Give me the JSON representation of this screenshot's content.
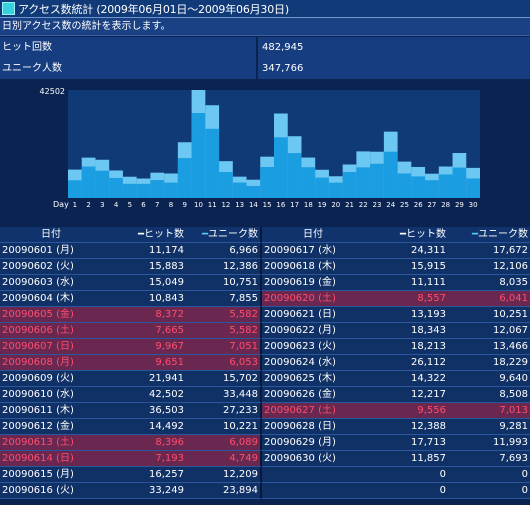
{
  "header": {
    "title": "アクセス数統計 (2009年06月01日～2009年06月30日)",
    "description": "日別アクセス数の統計を表示します。"
  },
  "summary": [
    {
      "label": "ヒット回数",
      "value": "482,945"
    },
    {
      "label": "ユニーク人数",
      "value": "347,766"
    }
  ],
  "colors": {
    "hits_bar": "#6cc8f2",
    "unique_bar": "#1b9de2",
    "weekend_row": "#6a2850",
    "weekend_text": "#ff4d6d",
    "plot_bg": "#0f3a76"
  },
  "chart_data": {
    "type": "bar",
    "max_label": "42502",
    "xlabel": "Day",
    "categories": [
      "1",
      "2",
      "3",
      "4",
      "5",
      "6",
      "7",
      "8",
      "9",
      "10",
      "11",
      "12",
      "13",
      "14",
      "15",
      "16",
      "17",
      "18",
      "19",
      "20",
      "21",
      "22",
      "23",
      "24",
      "25",
      "26",
      "27",
      "28",
      "29",
      "30"
    ],
    "series": [
      {
        "name": "ヒット数",
        "values": [
          11174,
          15883,
          15049,
          10843,
          8372,
          7665,
          9967,
          9651,
          21941,
          42502,
          36503,
          14492,
          8396,
          7193,
          16257,
          33249,
          24311,
          15915,
          11111,
          8557,
          13193,
          18343,
          18213,
          26112,
          14322,
          12217,
          9556,
          12388,
          17713,
          11857
        ]
      },
      {
        "name": "ユニーク数",
        "values": [
          6966,
          12386,
          10751,
          7855,
          5582,
          5582,
          7051,
          6053,
          15702,
          33448,
          27233,
          10221,
          6089,
          4749,
          12209,
          23894,
          17672,
          12106,
          8035,
          6041,
          10251,
          12067,
          13466,
          18229,
          9640,
          8508,
          7013,
          9281,
          11993,
          7693
        ]
      }
    ],
    "ylim": [
      0,
      42502
    ]
  },
  "table": {
    "headers": {
      "date": "日付",
      "hits": "ヒット数",
      "unique": "ユニーク数",
      "dash": "━"
    },
    "rows_left": [
      {
        "date": "20090601 (月)",
        "hits": "11,174",
        "unique": "6,966",
        "weekend": false
      },
      {
        "date": "20090602 (火)",
        "hits": "15,883",
        "unique": "12,386",
        "weekend": false
      },
      {
        "date": "20090603 (水)",
        "hits": "15,049",
        "unique": "10,751",
        "weekend": false
      },
      {
        "date": "20090604 (木)",
        "hits": "10,843",
        "unique": "7,855",
        "weekend": false
      },
      {
        "date": "20090605 (金)",
        "hits": "8,372",
        "unique": "5,582",
        "weekend": true
      },
      {
        "date": "20090606 (土)",
        "hits": "7,665",
        "unique": "5,582",
        "weekend": true
      },
      {
        "date": "20090607 (日)",
        "hits": "9,967",
        "unique": "7,051",
        "weekend": true
      },
      {
        "date": "20090608 (月)",
        "hits": "9,651",
        "unique": "6,053",
        "weekend": true
      },
      {
        "date": "20090609 (火)",
        "hits": "21,941",
        "unique": "15,702",
        "weekend": false
      },
      {
        "date": "20090610 (水)",
        "hits": "42,502",
        "unique": "33,448",
        "weekend": false
      },
      {
        "date": "20090611 (木)",
        "hits": "36,503",
        "unique": "27,233",
        "weekend": false
      },
      {
        "date": "20090612 (金)",
        "hits": "14,492",
        "unique": "10,221",
        "weekend": false
      },
      {
        "date": "20090613 (土)",
        "hits": "8,396",
        "unique": "6,089",
        "weekend": true
      },
      {
        "date": "20090614 (日)",
        "hits": "7,193",
        "unique": "4,749",
        "weekend": true
      },
      {
        "date": "20090615 (月)",
        "hits": "16,257",
        "unique": "12,209",
        "weekend": false
      },
      {
        "date": "20090616 (火)",
        "hits": "33,249",
        "unique": "23,894",
        "weekend": false
      }
    ],
    "rows_right": [
      {
        "date": "20090617 (水)",
        "hits": "24,311",
        "unique": "17,672",
        "weekend": false
      },
      {
        "date": "20090618 (木)",
        "hits": "15,915",
        "unique": "12,106",
        "weekend": false
      },
      {
        "date": "20090619 (金)",
        "hits": "11,111",
        "unique": "8,035",
        "weekend": false
      },
      {
        "date": "20090620 (土)",
        "hits": "8,557",
        "unique": "6,041",
        "weekend": true
      },
      {
        "date": "20090621 (日)",
        "hits": "13,193",
        "unique": "10,251",
        "weekend": false
      },
      {
        "date": "20090622 (月)",
        "hits": "18,343",
        "unique": "12,067",
        "weekend": false
      },
      {
        "date": "20090623 (火)",
        "hits": "18,213",
        "unique": "13,466",
        "weekend": false
      },
      {
        "date": "20090624 (水)",
        "hits": "26,112",
        "unique": "18,229",
        "weekend": false
      },
      {
        "date": "20090625 (木)",
        "hits": "14,322",
        "unique": "9,640",
        "weekend": false
      },
      {
        "date": "20090626 (金)",
        "hits": "12,217",
        "unique": "8,508",
        "weekend": false
      },
      {
        "date": "20090627 (土)",
        "hits": "9,556",
        "unique": "7,013",
        "weekend": true
      },
      {
        "date": "20090628 (日)",
        "hits": "12,388",
        "unique": "9,281",
        "weekend": false
      },
      {
        "date": "20090629 (月)",
        "hits": "17,713",
        "unique": "11,993",
        "weekend": false
      },
      {
        "date": "20090630 (火)",
        "hits": "11,857",
        "unique": "7,693",
        "weekend": false
      },
      {
        "date": "",
        "hits": "0",
        "unique": "0",
        "weekend": false
      },
      {
        "date": "",
        "hits": "0",
        "unique": "0",
        "weekend": false
      }
    ]
  }
}
